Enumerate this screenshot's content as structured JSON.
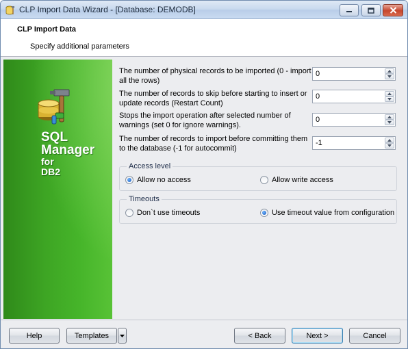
{
  "window": {
    "title": "CLP Import Data Wizard - [Database: DEMODB]",
    "controls": [
      "minimize-icon",
      "maximize-icon",
      "close-icon"
    ]
  },
  "header": {
    "title": "CLP Import Data",
    "subtitle": "Specify additional parameters"
  },
  "sidebar": {
    "brand_line1": "SQL",
    "brand_line2": "Manager",
    "brand_line3": "for",
    "brand_line4": "DB2",
    "icon": "database-hammer-icon"
  },
  "params": [
    {
      "label": "The number of physical records to be imported (0 - import all the rows)",
      "value": "0"
    },
    {
      "label": "The number of records to skip before starting to insert or update records (Restart Count)",
      "value": "0"
    },
    {
      "label": "Stops the import operation after selected number of warnings (set 0 for ignore warnings).",
      "value": "0"
    },
    {
      "label": "The number of records to import before committing them to the database (-1 for autocommit)",
      "value": "-1"
    }
  ],
  "access_level": {
    "title": "Access level",
    "options": [
      {
        "label": "Allow no access",
        "selected": true
      },
      {
        "label": "Allow write access",
        "selected": false
      }
    ]
  },
  "timeouts": {
    "title": "Timeouts",
    "options": [
      {
        "label": "Don`t use timeouts",
        "selected": false
      },
      {
        "label": "Use timeout value from configuration",
        "selected": true
      }
    ]
  },
  "buttons": {
    "help": "Help",
    "templates": "Templates",
    "back": "< Back",
    "next": "Next >",
    "cancel": "Cancel"
  },
  "colors": {
    "sidebar_green": "#3ea624",
    "accent_blue": "#1b57b8"
  }
}
